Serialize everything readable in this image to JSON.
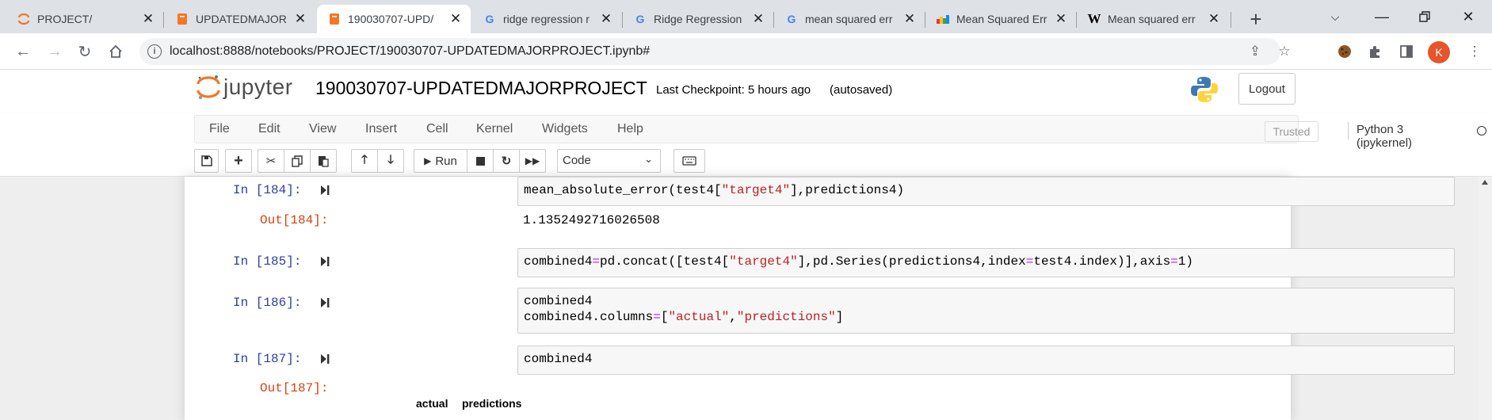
{
  "browser": {
    "tabs": [
      {
        "title": "PROJECT/",
        "favicon": "jupyter-icon"
      },
      {
        "title": "UPDATEDMAJOR",
        "favicon": "jupyter-notebook-icon"
      },
      {
        "title": "190030707-UPD/",
        "favicon": "jupyter-notebook-icon",
        "active": true
      },
      {
        "title": "ridge regression r",
        "favicon": "google-icon"
      },
      {
        "title": "Ridge Regression",
        "favicon": "google-icon"
      },
      {
        "title": "mean squared err",
        "favicon": "google-icon"
      },
      {
        "title": "Mean Squared Err",
        "favicon": "chart-favicon-icon"
      },
      {
        "title": "Mean squared err",
        "favicon": "wikipedia-icon"
      }
    ],
    "url": "localhost:8888/notebooks/PROJECT/190030707-UPDATEDMAJORPROJECT.ipynb#",
    "profile_initial": "K"
  },
  "jupyter": {
    "logo_text": "jupyter",
    "notebook_name": "190030707-UPDATEDMAJORPROJECT",
    "checkpoint": "Last Checkpoint: 5 hours ago",
    "autosave": "(autosaved)",
    "logout_label": "Logout",
    "menus": [
      "File",
      "Edit",
      "View",
      "Insert",
      "Cell",
      "Kernel",
      "Widgets",
      "Help"
    ],
    "trusted_label": "Trusted",
    "kernel_name": "Python 3 (ipykernel)",
    "run_label": "Run",
    "cell_type": "Code"
  },
  "cells": [
    {
      "prompt": "In [184]:",
      "code": "mean_absolute_error(test4[\"target4\"],predictions4)",
      "out_prompt": "Out[184]:",
      "output": "1.1352492716026508"
    },
    {
      "prompt": "In [185]:",
      "code": "combined4=pd.concat([test4[\"target4\"],pd.Series(predictions4,index=test4.index)],axis=1)"
    },
    {
      "prompt": "In [186]:",
      "code": "combined4\ncombined4.columns=[\"actual\",\"predictions\"]"
    },
    {
      "prompt": "In [187]:",
      "code": "combined4",
      "out_prompt": "Out[187]:",
      "table_headers": [
        "actual",
        "predictions"
      ]
    }
  ],
  "colors": {
    "in_prompt": "#303f9f",
    "out_prompt": "#d84315",
    "string": "#ba2121",
    "operator": "#aa22ff",
    "profile": "#e8542b"
  }
}
